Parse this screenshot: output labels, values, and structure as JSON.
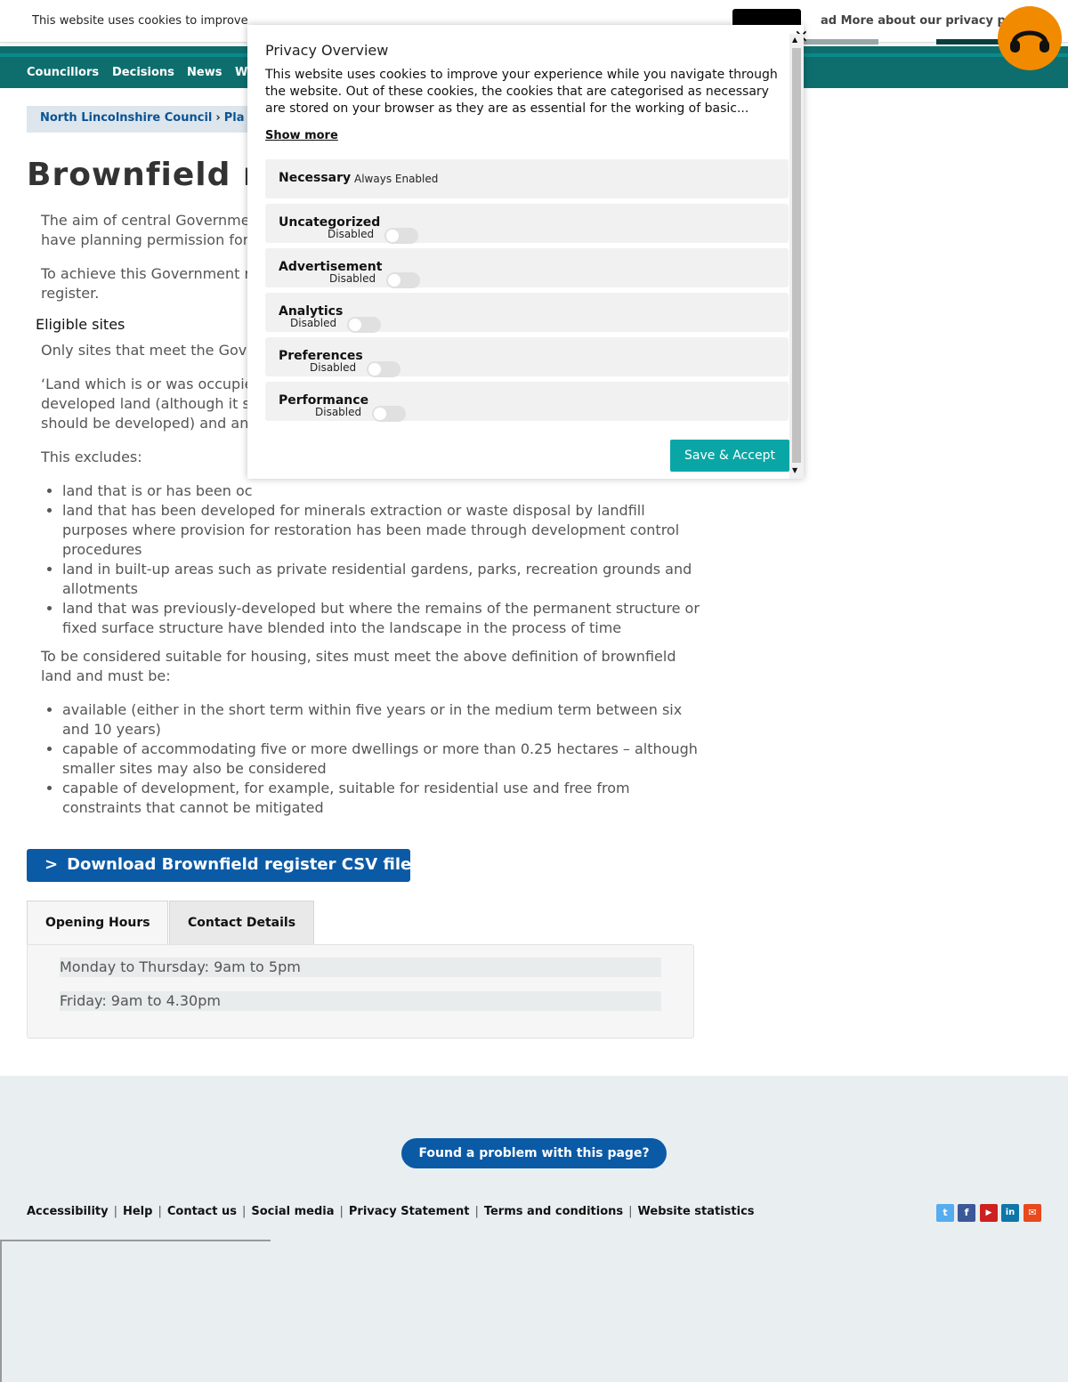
{
  "cookie_bar": {
    "message": "This website uses cookies to improve",
    "read_more": "ad More about our privacy p"
  },
  "nav": {
    "items": [
      "Councillors",
      "Decisions",
      "News",
      "W"
    ]
  },
  "breadcrumb": {
    "home": "North Lincolnshire Council",
    "next": "Pla"
  },
  "page": {
    "title": "Brownfield re",
    "intro_1": "The aim of central Governme",
    "intro_1b": "have planning permission for",
    "intro_2": "To achieve this Government r",
    "intro_2b": "register.",
    "eligible_heading": "Eligible sites",
    "eligible_p1": "Only sites that meet the Gov",
    "eligible_p2a": "‘Land which is or was occupie",
    "eligible_p2b": "developed land (although it s",
    "eligible_p2c": "should be developed) and an",
    "excludes_label": "This excludes:",
    "excludes": [
      "land that is or has been oc",
      "land that has been developed for minerals extraction or waste disposal by landfill purposes where provision for restoration has been made through development control procedures",
      "land in built-up areas such as private residential gardens, parks, recreation grounds and allotments",
      "land that was previously-developed but where the remains of the permanent structure or fixed surface structure have blended into the landscape in the process of time"
    ],
    "suitable_p": "To be considered suitable for housing, sites must meet the above definition of brownfield land and must be:",
    "suitable": [
      "available (either in the short term within five years or in the medium term between six and 10 years)",
      "capable of accommodating five or more dwellings or more than 0.25 hectares – although smaller sites may also be considered",
      "capable of development, for example, suitable for residential use and free from constraints that cannot be mitigated"
    ],
    "download_chevron": ">",
    "download_label": "Download Brownfield register CSV file"
  },
  "tabs": {
    "opening_hours": "Opening Hours",
    "contact_details": "Contact Details",
    "hours": [
      "Monday to Thursday: 9am to 5pm",
      "Friday: 9am to 4.30pm"
    ]
  },
  "footer": {
    "problem": "Found a problem with this page?",
    "links": [
      "Accessibility",
      "Help",
      "Contact us",
      "Social media",
      "Privacy Statement",
      "Terms and conditions",
      "Website statistics"
    ],
    "social": [
      {
        "icon": "twitter-icon",
        "color": "#55acee",
        "glyph": "t"
      },
      {
        "icon": "facebook-icon",
        "color": "#3b5998",
        "glyph": "f"
      },
      {
        "icon": "youtube-icon",
        "color": "#cd201f",
        "glyph": "▶"
      },
      {
        "icon": "linkedin-icon",
        "color": "#0e76a8",
        "glyph": "in"
      },
      {
        "icon": "email-icon",
        "color": "#e8491d",
        "glyph": "✉"
      }
    ]
  },
  "modal": {
    "close": "×",
    "title": "Privacy Overview",
    "description": "This website uses cookies to improve your experience while you navigate through the website. Out of these cookies, the cookies that are categorised as necessary are stored on your browser as they are as essential for the working of basic...",
    "show_more": "Show more",
    "necessary": "Necessary",
    "always_enabled": "Always Enabled",
    "categories": [
      {
        "name": "Uncategorized",
        "state": "Disabled"
      },
      {
        "name": "Advertisement",
        "state": "Disabled"
      },
      {
        "name": "Analytics",
        "state": "Disabled"
      },
      {
        "name": "Preferences",
        "state": "Disabled"
      },
      {
        "name": "Performance",
        "state": "Disabled"
      }
    ],
    "save": "Save & Accept"
  },
  "colors": {
    "nav": "#0e6e6e",
    "primary_button": "#0b5aa6",
    "save_button": "#0aa6a6",
    "help_circle": "#f28a00"
  }
}
